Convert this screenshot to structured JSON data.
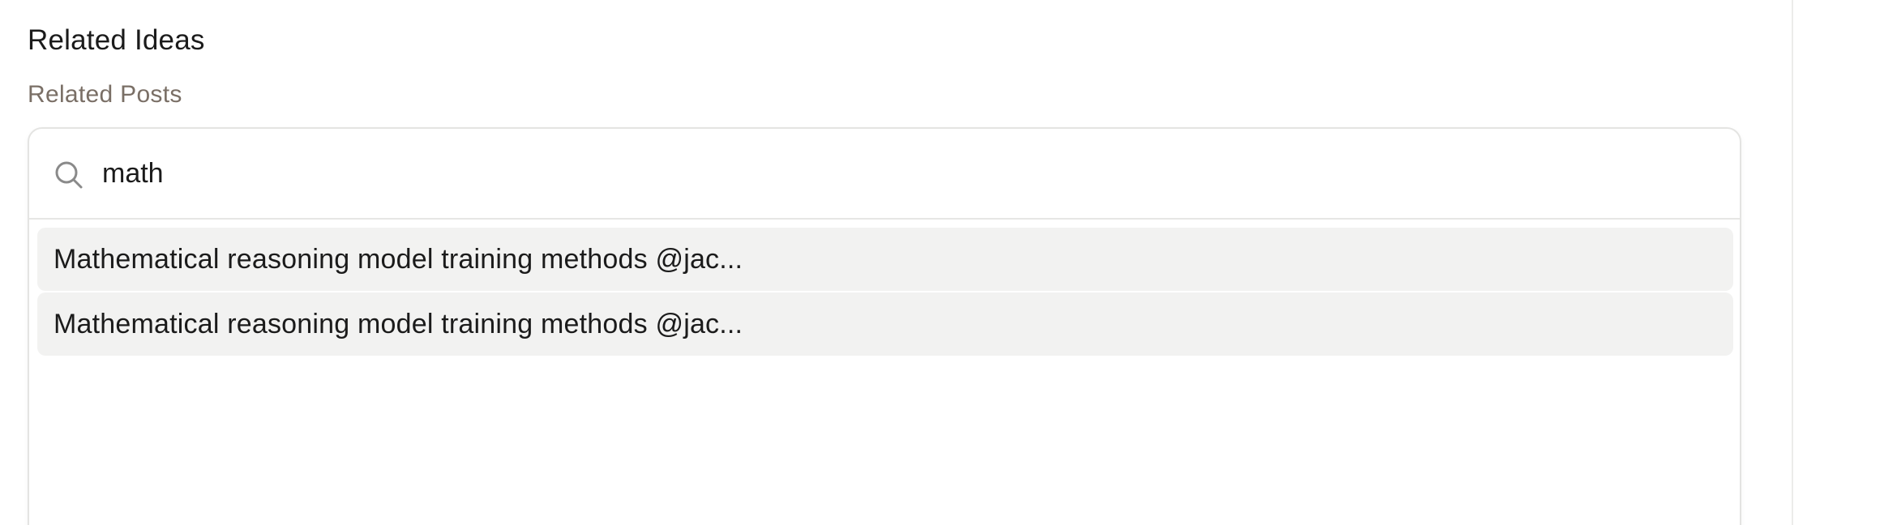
{
  "section": {
    "title": "Related Ideas",
    "subtitle": "Related Posts"
  },
  "search": {
    "value": "math",
    "icon": "search-icon"
  },
  "results": [
    {
      "label": "Mathematical reasoning model training methods @jac..."
    },
    {
      "label": "Mathematical reasoning model training methods @jac..."
    }
  ]
}
